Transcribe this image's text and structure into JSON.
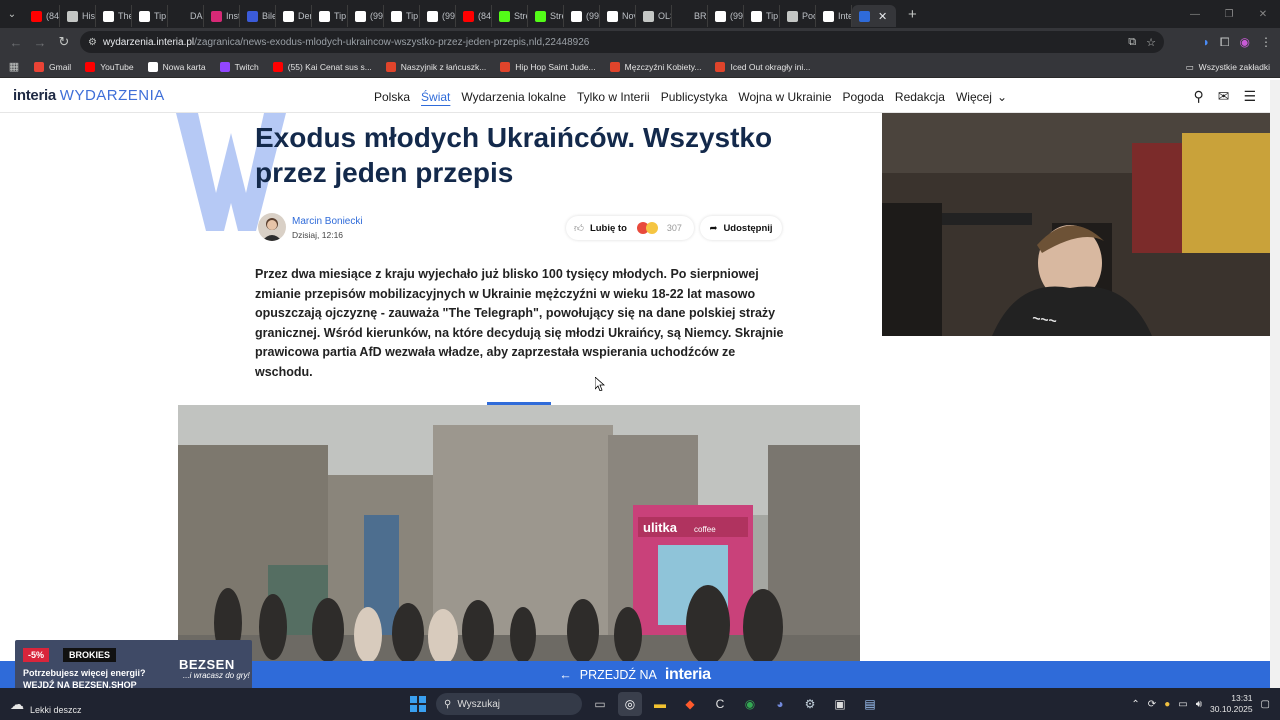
{
  "browser": {
    "tabs": [
      {
        "label": "(84)",
        "color": "#ff0000"
      },
      {
        "label": "Hist",
        "color": "#c4c7c5"
      },
      {
        "label": "The",
        "color": "#ffffff"
      },
      {
        "label": "Tip",
        "color": "#ffffff"
      },
      {
        "label": "DAL",
        "color": "#202124"
      },
      {
        "label": "Insta",
        "color": "#d62976"
      },
      {
        "label": "Bile",
        "color": "#3b5bd9"
      },
      {
        "label": "Der",
        "color": "#ffffff"
      },
      {
        "label": "Tip",
        "color": "#ffffff"
      },
      {
        "label": "(99",
        "color": "#ffffff"
      },
      {
        "label": "Tip",
        "color": "#ffffff"
      },
      {
        "label": "(99",
        "color": "#ffffff"
      },
      {
        "label": "(84)",
        "color": "#ff0000"
      },
      {
        "label": "Stre",
        "color": "#53fc18"
      },
      {
        "label": "Stre",
        "color": "#53fc18"
      },
      {
        "label": "(99",
        "color": "#ffffff"
      },
      {
        "label": "Nov",
        "color": "#ffffff"
      },
      {
        "label": "OLS",
        "color": "#c4c7c5"
      },
      {
        "label": "BRC",
        "color": "#202124"
      },
      {
        "label": "(99",
        "color": "#ffffff"
      },
      {
        "label": "Tip",
        "color": "#ffffff"
      },
      {
        "label": "Pod",
        "color": "#c4c7c5"
      },
      {
        "label": "Inte",
        "color": "#ffffff"
      }
    ],
    "active_tab_color": "#2f6bd9",
    "url_domain": "wydarzenia.interia.pl",
    "url_path": "/zagranica/news-exodus-mlodych-ukraincow-wszystko-przez-jeden-przepis,nld,22448926",
    "bookmarks": [
      {
        "label": "Gmail",
        "color": "#ea4335"
      },
      {
        "label": "YouTube",
        "color": "#ff0000"
      },
      {
        "label": "Nowa karta",
        "color": "#ffffff"
      },
      {
        "label": "Twitch",
        "color": "#9146ff"
      },
      {
        "label": "(55) Kai Cenat sus s...",
        "color": "#ff0000"
      },
      {
        "label": "Naszyjnik z łańcuszk...",
        "color": "#e0442b"
      },
      {
        "label": "Hip Hop Saint Jude...",
        "color": "#e0442b"
      },
      {
        "label": "Męzczyźni Kobiety...",
        "color": "#e0442b"
      },
      {
        "label": "Iced Out okragły ini...",
        "color": "#e0442b"
      }
    ],
    "all_bookmarks": "Wszystkie zakładki"
  },
  "site": {
    "logo_main": "interia",
    "logo_sub": "WYDARZENIA",
    "nav": [
      {
        "label": "Polska",
        "active": false
      },
      {
        "label": "Świat",
        "active": true
      },
      {
        "label": "Wydarzenia lokalne",
        "active": false
      },
      {
        "label": "Tylko w Interii",
        "active": false
      },
      {
        "label": "Publicystyka",
        "active": false
      },
      {
        "label": "Wojna w Ukrainie",
        "active": false
      },
      {
        "label": "Pogoda",
        "active": false
      },
      {
        "label": "Redakcja",
        "active": false
      },
      {
        "label": "Więcej",
        "active": false
      }
    ]
  },
  "article": {
    "title": "Exodus młodych Ukraińców. Wszystko przez jeden przepis",
    "author": "Marcin Boniecki",
    "date": "Dzisiaj, 12:16",
    "like_label": "Lubię to",
    "reactions_count": "307",
    "share_label": "Udostępnij",
    "lead": "Przez dwa miesiące z kraju wyjechało już blisko 100 tysięcy młodych. Po sierpniowej zmianie przepisów mobilizacyjnych w Ukrainie mężczyźni w wieku 18-22 lat masowo opuszczają ojczyznę - zauważa \"The Telegraph\", powołujący się na dane polskiej straży granicznej. Wśród kierunków, na które decydują się młodzi Ukraińcy, są Niemcy. Skrajnie prawicowa partia AfD wezwała władze, aby zaprzestała wspierania uchodźców ze wschodu.",
    "photo_kiosk_brand": "ulitka",
    "photo_kiosk_sub": "coffee"
  },
  "banner": {
    "text": "PRZEJDŹ NA",
    "brand": "interia"
  },
  "ad": {
    "discount": "-5%",
    "brand_small": "BROKIES",
    "line1": "Potrzebujesz więcej energii?",
    "line2": "WEJDŹ NA BEZSEN.SHOP",
    "brand_big": "BEZSEN",
    "tagline": "...i wracasz do gry!"
  },
  "taskbar": {
    "weather": "Lekki deszcz",
    "search_placeholder": "Wyszukaj",
    "time": "13:31",
    "date": "30.10.2025"
  }
}
